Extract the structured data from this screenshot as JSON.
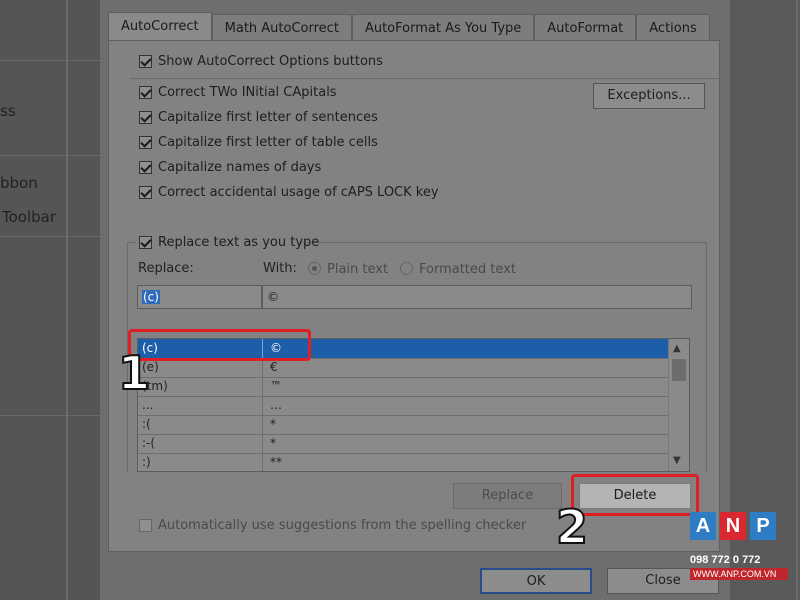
{
  "background": {
    "left_items": [
      "ss",
      "bbon",
      "Toolbar"
    ]
  },
  "tabs": [
    {
      "label": "AutoCorrect",
      "active": true
    },
    {
      "label": "Math AutoCorrect",
      "active": false
    },
    {
      "label": "AutoFormat As You Type",
      "active": false
    },
    {
      "label": "AutoFormat",
      "active": false
    },
    {
      "label": "Actions",
      "active": false
    }
  ],
  "options": {
    "show_buttons": "Show AutoCorrect Options buttons",
    "two_initial": "Correct TWo INitial CApitals",
    "sentences": "Capitalize first letter of sentences",
    "table_cells": "Capitalize first letter of table cells",
    "days": "Capitalize names of days",
    "caps_lock": "Correct accidental usage of cAPS LOCK key",
    "replace_as_type": "Replace text as you type",
    "suggestions": "Automatically use suggestions from the spelling checker"
  },
  "buttons": {
    "exceptions": "Exceptions...",
    "replace": "Replace",
    "delete": "Delete",
    "ok": "OK",
    "close": "Close"
  },
  "replace_section": {
    "replace_label": "Replace:",
    "with_label": "With:",
    "plain_text": "Plain text",
    "formatted_text": "Formatted text",
    "replace_value": "(c)",
    "with_value": "©"
  },
  "entries": [
    {
      "from": "(c)",
      "to": "©"
    },
    {
      "from": "(e)",
      "to": "€"
    },
    {
      "from": "(tm)",
      "to": "™"
    },
    {
      "from": "...",
      "to": "…"
    },
    {
      "from": ":(",
      "to": "*"
    },
    {
      "from": ":-(",
      "to": "*"
    },
    {
      "from": ":)",
      "to": "**"
    }
  ],
  "annotations": {
    "step1": "1",
    "step2": "2"
  },
  "logo": {
    "letters": [
      "A",
      "N",
      "P"
    ],
    "phone": "098 772 0 772",
    "website": "WWW.ANP.COM.VN"
  },
  "colors": {
    "accent": "#1d5ea8",
    "annotation": "#e01e24"
  }
}
